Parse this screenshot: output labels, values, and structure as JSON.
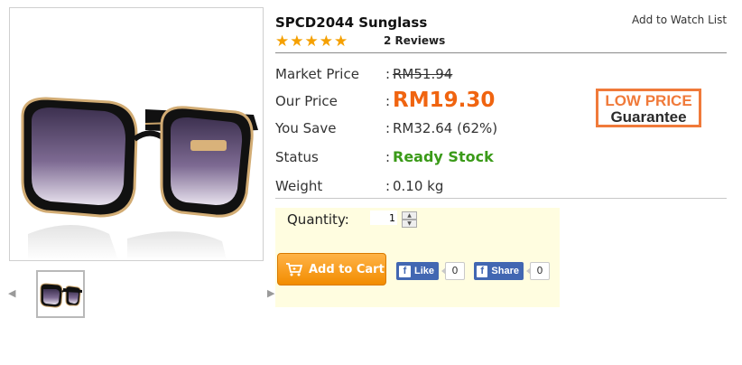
{
  "product": {
    "title": "SPCD2044 Sunglass",
    "rating_stars": "★★★★★",
    "reviews": "2 Reviews",
    "watch_list": "Add to Watch List"
  },
  "details": [
    {
      "label": "Market Price",
      "colon": ":",
      "value": "RM51.94"
    },
    {
      "label": "Our Price",
      "colon": ":",
      "value": "RM19.30"
    },
    {
      "label": "You Save",
      "colon": ":",
      "value": "RM32.64 (62%)"
    },
    {
      "label": "Status",
      "colon": ":",
      "value": "Ready Stock"
    },
    {
      "label": "Weight",
      "colon": ":",
      "value": "0.10 kg"
    }
  ],
  "badge": {
    "line1": "LOW PRICE",
    "line2": "Guarantee"
  },
  "cart": {
    "quantity_label": "Quantity:",
    "quantity_value": "1",
    "add_to_cart": "Add to Cart"
  },
  "social": {
    "like_label": "Like",
    "like_count": "0",
    "share_label": "Share",
    "share_count": "0"
  },
  "colors": {
    "price_orange": "#f06410",
    "status_green": "#3a9a18",
    "star": "#f5a000",
    "facebook": "#4267b2"
  },
  "icons": [
    "star-icon",
    "cart-icon",
    "facebook-icon",
    "arrow-left-icon",
    "arrow-right-icon",
    "spinner-up-icon",
    "spinner-down-icon"
  ]
}
